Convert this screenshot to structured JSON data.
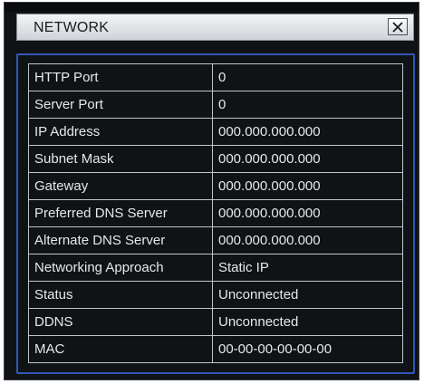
{
  "window": {
    "title": "NETWORK",
    "close_icon": "close-x-icon"
  },
  "network": {
    "rows": [
      {
        "label": "HTTP Port",
        "value": "0"
      },
      {
        "label": "Server Port",
        "value": "0"
      },
      {
        "label": "IP Address",
        "value": "000.000.000.000"
      },
      {
        "label": "Subnet Mask",
        "value": "000.000.000.000"
      },
      {
        "label": "Gateway",
        "value": "000.000.000.000"
      },
      {
        "label": "Preferred DNS Server",
        "value": "000.000.000.000"
      },
      {
        "label": "Alternate DNS Server",
        "value": "000.000.000.000"
      },
      {
        "label": "Networking Approach",
        "value": "Static IP"
      },
      {
        "label": "Status",
        "value": "Unconnected"
      },
      {
        "label": "DDNS",
        "value": "Unconnected"
      },
      {
        "label": "MAC",
        "value": "00-00-00-00-00-00"
      }
    ]
  },
  "colors": {
    "background": "#101316",
    "panel_border": "#3157b8",
    "text": "#e6e8ea"
  }
}
